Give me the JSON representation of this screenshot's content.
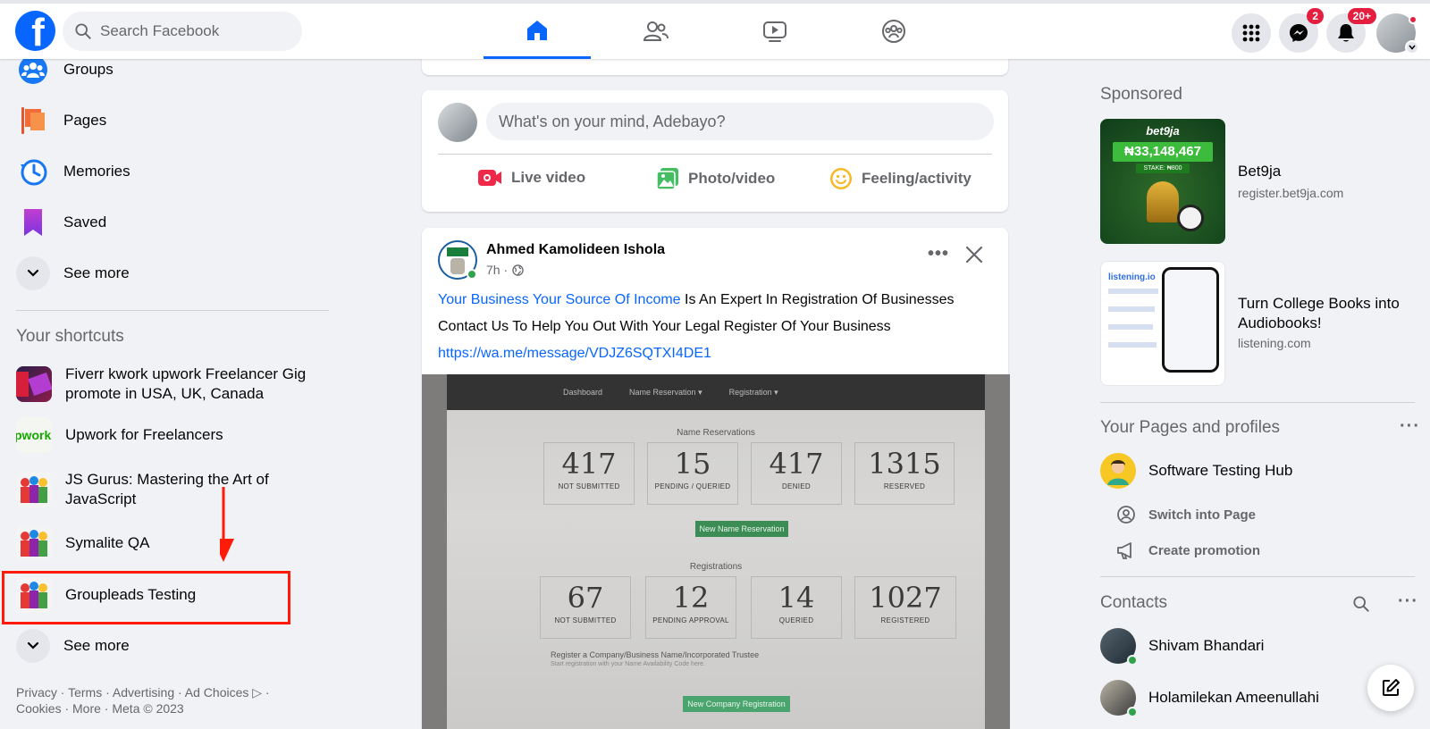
{
  "header": {
    "search_placeholder": "Search Facebook",
    "messenger_badge": "2",
    "notifications_badge": "20+",
    "accent": "#0866ff"
  },
  "left_nav": {
    "items": [
      {
        "label": "Groups",
        "icon": "groups-icon"
      },
      {
        "label": "Pages",
        "icon": "pages-flag-icon"
      },
      {
        "label": "Memories",
        "icon": "memories-clock-icon"
      },
      {
        "label": "Saved",
        "icon": "saved-bookmark-icon"
      }
    ],
    "see_more": "See more"
  },
  "shortcuts": {
    "heading": "Your shortcuts",
    "items": [
      {
        "label": "Fiverr kwork upwork Freelancer Gig promote in USA, UK, Canada"
      },
      {
        "label": "Upwork for Freelancers"
      },
      {
        "label": "JS Gurus: Mastering the Art of JavaScript"
      },
      {
        "label": "Symalite QA"
      },
      {
        "label": "Groupleads Testing"
      }
    ],
    "see_more": "See more"
  },
  "footer": {
    "links": "Privacy · Terms · Advertising · Ad Choices ▷ · Cookies · More · Meta © 2023"
  },
  "composer": {
    "placeholder": "What's on your mind, Adebayo?",
    "actions": [
      {
        "label": "Live video",
        "icon": "live-video-icon"
      },
      {
        "label": "Photo/video",
        "icon": "photo-icon"
      },
      {
        "label": "Feeling/activity",
        "icon": "smiley-icon"
      }
    ]
  },
  "post": {
    "author": "Ahmed Kamolideen Ishola",
    "time": "7h ·",
    "link_text": "Your Business Your Source Of Income",
    "text_1": " Is An Expert In Registration Of Businesses",
    "text_2": "Contact Us To Help You Out With Your Legal Register Of Your Business",
    "url": "https://wa.me/message/VDJZ6SQTXI4DE1",
    "photo": {
      "nav": [
        "Dashboard",
        "Name Reservation ▾",
        "Registration ▾"
      ],
      "section1": "Name Reservations",
      "stats1": [
        {
          "num": "417",
          "cap": "NOT SUBMITTED"
        },
        {
          "num": "15",
          "cap": "PENDING / QUERIED"
        },
        {
          "num": "417",
          "cap": "DENIED"
        },
        {
          "num": "1315",
          "cap": "RESERVED"
        }
      ],
      "button1": "New Name Reservation",
      "section2": "Registrations",
      "stats2": [
        {
          "num": "67",
          "cap": "NOT SUBMITTED"
        },
        {
          "num": "12",
          "cap": "PENDING APPROVAL"
        },
        {
          "num": "14",
          "cap": "QUERIED"
        },
        {
          "num": "1027",
          "cap": "REGISTERED"
        }
      ],
      "register_text": "Register a Company/Business Name/Incorporated Trustee",
      "register_sub": "Start registration with your Name Availability Code here.",
      "button2": "New Company Registration"
    }
  },
  "sponsored": {
    "heading": "Sponsored",
    "ads": [
      {
        "title": "Bet9ja",
        "url": "register.bet9ja.com",
        "thumb_brand": "bet9ja",
        "thumb_amount": "₦33,148,467",
        "thumb_stake": "STAKE: ₦800"
      },
      {
        "title": "Turn College Books into Audiobooks!",
        "url": "listening.com",
        "thumb_brand": "listening.io"
      }
    ]
  },
  "pages_profiles": {
    "heading": "Your Pages and profiles",
    "page_name": "Software Testing Hub",
    "switch_label": "Switch into Page",
    "promo_label": "Create promotion"
  },
  "contacts": {
    "heading": "Contacts",
    "items": [
      {
        "name": "Shivam Bhandari"
      },
      {
        "name": "Holamilekan Ameenullahi"
      }
    ]
  }
}
